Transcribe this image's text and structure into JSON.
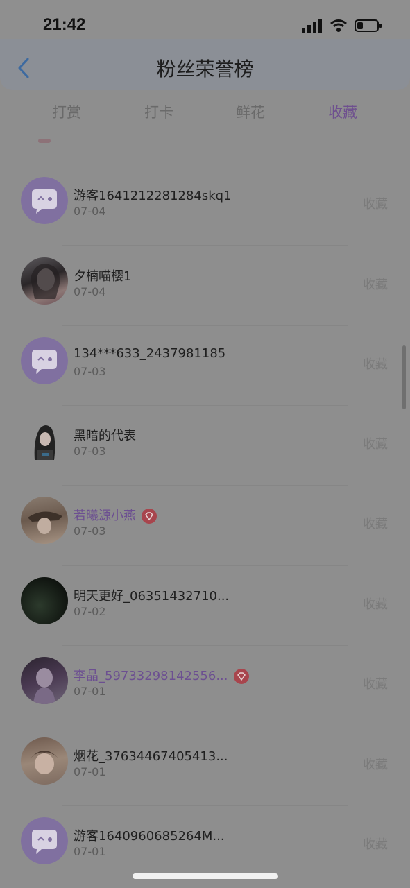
{
  "status_bar": {
    "time": "21:42"
  },
  "header": {
    "title": "粉丝荣誉榜"
  },
  "tabs": [
    {
      "label": "打赏",
      "active": false
    },
    {
      "label": "打卡",
      "active": false
    },
    {
      "label": "鲜花",
      "active": false
    },
    {
      "label": "收藏",
      "active": true
    }
  ],
  "rows": [
    {
      "name": "游客1641212281284skq1",
      "date": "07-04",
      "action": "收藏",
      "avatar": "chat-bubble-avatar",
      "vip": false
    },
    {
      "name": "夕楠喵樱1",
      "date": "07-04",
      "action": "收藏",
      "avatar": "photo-avatar",
      "vip": false
    },
    {
      "name": "134***633_2437981185",
      "date": "07-03",
      "action": "收藏",
      "avatar": "chat-bubble-avatar",
      "vip": false
    },
    {
      "name": "黑暗的代表",
      "date": "07-03",
      "action": "收藏",
      "avatar": "anime-avatar",
      "vip": false
    },
    {
      "name": "若曦源小燕",
      "date": "07-03",
      "action": "收藏",
      "avatar": "photo-avatar",
      "vip": true
    },
    {
      "name": "明天更好_06351432710...",
      "date": "07-02",
      "action": "收藏",
      "avatar": "dark-avatar",
      "vip": false
    },
    {
      "name": "李晶_59733298142556...",
      "date": "07-01",
      "action": "收藏",
      "avatar": "photo-avatar",
      "vip": true
    },
    {
      "name": "烟花_37634467405413...",
      "date": "07-01",
      "action": "收藏",
      "avatar": "photo-avatar",
      "vip": false
    },
    {
      "name": "游客1640960685264M...",
      "date": "07-01",
      "action": "收藏",
      "avatar": "chat-bubble-avatar",
      "vip": false
    }
  ],
  "colors": {
    "accent": "#6e4f8f",
    "badge": "#a8454d"
  }
}
